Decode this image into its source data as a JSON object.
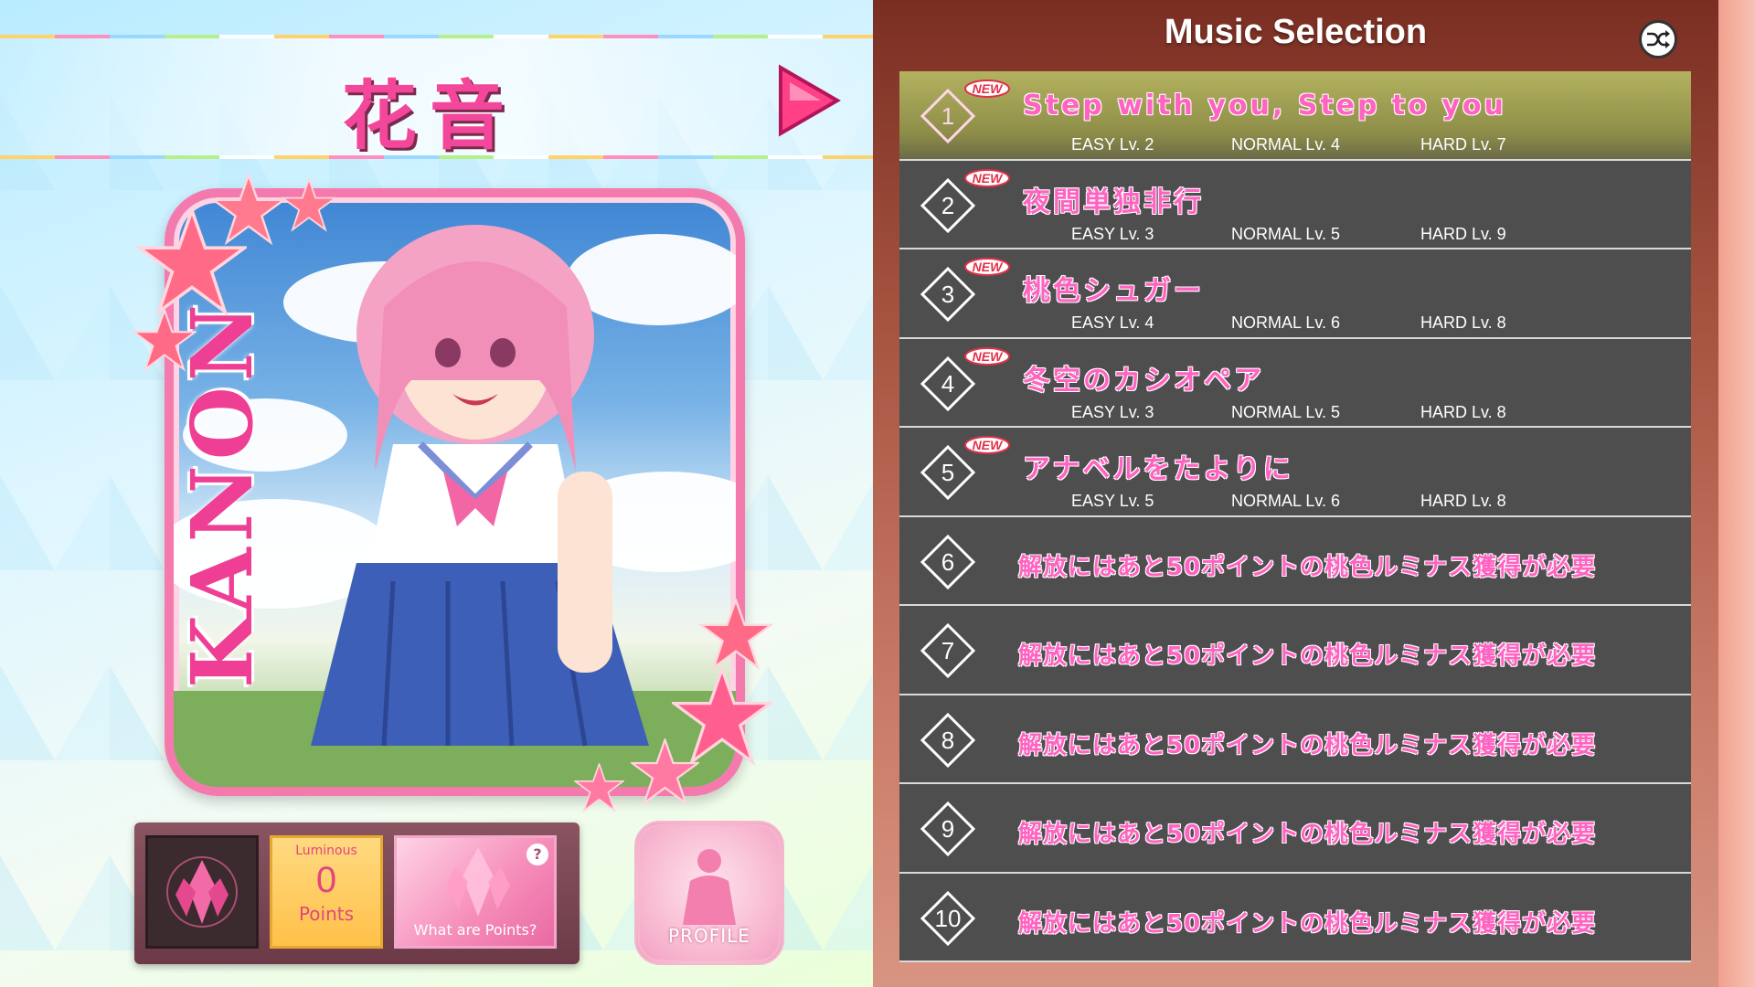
{
  "character": {
    "name_jp": "花音",
    "name_en": "KANON"
  },
  "points": {
    "label_top": "Luminous",
    "value": "0",
    "label_bottom": "Points",
    "help_button": "What are Points?",
    "help_badge": "?"
  },
  "profile_button": "PROFILE",
  "music": {
    "title": "Music Selection",
    "new_badge": "NEW",
    "songs": [
      {
        "num": "1",
        "title": "Step with you, Step to you",
        "easy": "EASY  Lv. 2",
        "normal": "NORMAL  Lv. 4",
        "hard": "HARD  Lv. 7"
      },
      {
        "num": "2",
        "title": "夜間単独非行",
        "easy": "EASY  Lv. 3",
        "normal": "NORMAL  Lv. 5",
        "hard": "HARD  Lv. 9"
      },
      {
        "num": "3",
        "title": "桃色シュガー",
        "easy": "EASY  Lv. 4",
        "normal": "NORMAL  Lv. 6",
        "hard": "HARD  Lv. 8"
      },
      {
        "num": "4",
        "title": "冬空のカシオペア",
        "easy": "EASY  Lv. 3",
        "normal": "NORMAL  Lv. 5",
        "hard": "HARD  Lv. 8"
      },
      {
        "num": "5",
        "title": "アナベルをたよりに",
        "easy": "EASY  Lv. 5",
        "normal": "NORMAL  Lv. 6",
        "hard": "HARD  Lv. 8"
      }
    ],
    "locked": [
      {
        "num": "6",
        "text": "解放にはあと50ポイントの桃色ルミナス獲得が必要"
      },
      {
        "num": "7",
        "text": "解放にはあと50ポイントの桃色ルミナス獲得が必要"
      },
      {
        "num": "8",
        "text": "解放にはあと50ポイントの桃色ルミナス獲得が必要"
      },
      {
        "num": "9",
        "text": "解放にはあと50ポイントの桃色ルミナス獲得が必要"
      },
      {
        "num": "10",
        "text": "解放にはあと50ポイントの桃色ルミナス獲得が必要"
      }
    ]
  },
  "colors": {
    "accent_pink": "#ff63c1",
    "selected_row": "#b3b25f",
    "row_bg": "#4e4e4e",
    "panel": "#7a2e22"
  }
}
